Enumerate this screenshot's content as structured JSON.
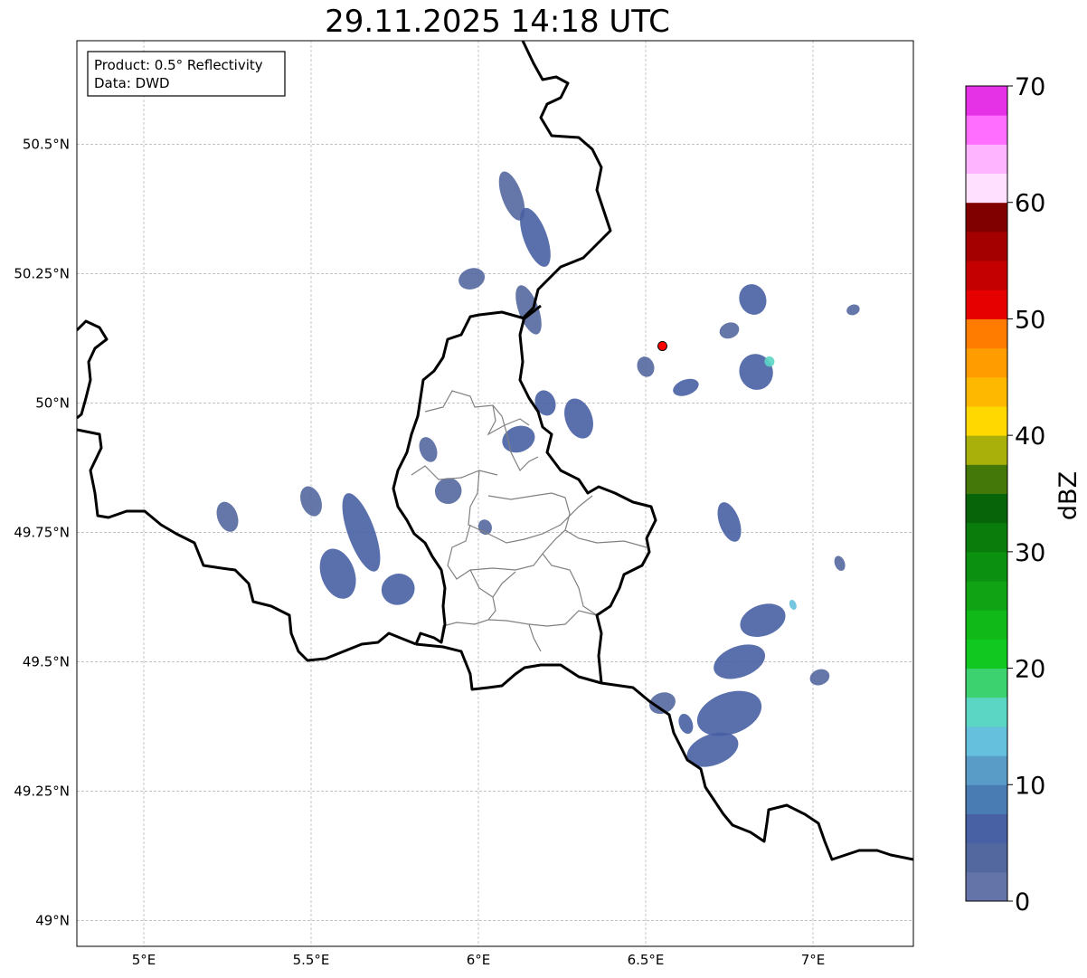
{
  "title": "29.11.2025 14:18 UTC",
  "info": {
    "product": "Product: 0.5° Reflectivity",
    "data": "Data: DWD"
  },
  "map_extent": {
    "lon": [
      4.8,
      7.3
    ],
    "lat": [
      48.95,
      50.7
    ]
  },
  "lon_ticks": [
    {
      "value": 5.0,
      "label": "5°E"
    },
    {
      "value": 5.5,
      "label": "5.5°E"
    },
    {
      "value": 6.0,
      "label": "6°E"
    },
    {
      "value": 6.5,
      "label": "6.5°E"
    },
    {
      "value": 7.0,
      "label": "7°E"
    }
  ],
  "lat_ticks": [
    {
      "value": 49.0,
      "label": "49°N"
    },
    {
      "value": 49.25,
      "label": "49.25°N"
    },
    {
      "value": 49.5,
      "label": "49.5°N"
    },
    {
      "value": 49.75,
      "label": "49.75°N"
    },
    {
      "value": 50.0,
      "label": "50°N"
    },
    {
      "value": 50.25,
      "label": "50.25°N"
    },
    {
      "value": 50.5,
      "label": "50.5°N"
    }
  ],
  "radar_site": {
    "lon": 6.55,
    "lat": 50.11,
    "color": "#ff0000"
  },
  "colorbar": {
    "unit": "dBZ",
    "min": 0,
    "max": 70,
    "ticks": [
      {
        "value": 0,
        "label": "0"
      },
      {
        "value": 10,
        "label": "10"
      },
      {
        "value": 20,
        "label": "20"
      },
      {
        "value": 30,
        "label": "30"
      },
      {
        "value": 40,
        "label": "40"
      },
      {
        "value": 50,
        "label": "50"
      },
      {
        "value": 60,
        "label": "60"
      },
      {
        "value": 70,
        "label": "70"
      }
    ],
    "colors": [
      "#6474a8",
      "#5468a0",
      "#4860a4",
      "#4a7cb4",
      "#5a9cc8",
      "#64c0dc",
      "#5cd6c4",
      "#3cd270",
      "#10c820",
      "#10b818",
      "#10a414",
      "#0c9010",
      "#0a7c0c",
      "#086408",
      "#447808",
      "#aab00a",
      "#ffd800",
      "#ffb800",
      "#ff9c00",
      "#ff7c00",
      "#e60000",
      "#c40000",
      "#a40000",
      "#800000",
      "#ffe0ff",
      "#ffb4ff",
      "#ff6eff",
      "#e632e6"
    ]
  },
  "colors": {
    "country_border": "#000000",
    "admin_border": "#808080",
    "grid": "#b0b0b0",
    "echo_default": "#5068a8"
  },
  "echoes": [
    {
      "lon": 6.1,
      "lat": 50.4,
      "w": 0.06,
      "h": 0.1,
      "value": 4
    },
    {
      "lon": 6.17,
      "lat": 50.32,
      "w": 0.07,
      "h": 0.12,
      "value": 5
    },
    {
      "lon": 6.15,
      "lat": 50.18,
      "w": 0.06,
      "h": 0.1,
      "value": 4
    },
    {
      "lon": 5.98,
      "lat": 50.24,
      "w": 0.08,
      "h": 0.04,
      "value": 3
    },
    {
      "lon": 6.3,
      "lat": 49.97,
      "w": 0.08,
      "h": 0.08,
      "value": 6
    },
    {
      "lon": 6.12,
      "lat": 49.93,
      "w": 0.1,
      "h": 0.05,
      "value": 6
    },
    {
      "lon": 6.2,
      "lat": 50.0,
      "w": 0.06,
      "h": 0.05,
      "value": 5
    },
    {
      "lon": 5.85,
      "lat": 49.91,
      "w": 0.05,
      "h": 0.05,
      "value": 4
    },
    {
      "lon": 5.65,
      "lat": 49.75,
      "w": 0.08,
      "h": 0.16,
      "value": 5
    },
    {
      "lon": 5.58,
      "lat": 49.67,
      "w": 0.1,
      "h": 0.1,
      "value": 6
    },
    {
      "lon": 5.76,
      "lat": 49.64,
      "w": 0.1,
      "h": 0.06,
      "value": 5
    },
    {
      "lon": 5.5,
      "lat": 49.81,
      "w": 0.06,
      "h": 0.06,
      "value": 4
    },
    {
      "lon": 5.91,
      "lat": 49.83,
      "w": 0.08,
      "h": 0.05,
      "value": 4
    },
    {
      "lon": 6.02,
      "lat": 49.76,
      "w": 0.04,
      "h": 0.03,
      "value": 3
    },
    {
      "lon": 5.25,
      "lat": 49.78,
      "w": 0.06,
      "h": 0.06,
      "value": 4
    },
    {
      "lon": 6.75,
      "lat": 49.77,
      "w": 0.06,
      "h": 0.08,
      "value": 5
    },
    {
      "lon": 6.83,
      "lat": 50.06,
      "w": 0.1,
      "h": 0.07,
      "value": 7
    },
    {
      "lon": 6.82,
      "lat": 50.2,
      "w": 0.08,
      "h": 0.06,
      "value": 5
    },
    {
      "lon": 6.75,
      "lat": 50.14,
      "w": 0.06,
      "h": 0.03,
      "value": 4
    },
    {
      "lon": 6.62,
      "lat": 50.03,
      "w": 0.08,
      "h": 0.03,
      "value": 5
    },
    {
      "lon": 6.5,
      "lat": 50.07,
      "w": 0.05,
      "h": 0.04,
      "value": 4
    },
    {
      "lon": 6.85,
      "lat": 49.58,
      "w": 0.14,
      "h": 0.06,
      "value": 5
    },
    {
      "lon": 6.78,
      "lat": 49.5,
      "w": 0.16,
      "h": 0.06,
      "value": 5
    },
    {
      "lon": 6.75,
      "lat": 49.4,
      "w": 0.2,
      "h": 0.08,
      "value": 5
    },
    {
      "lon": 6.7,
      "lat": 49.33,
      "w": 0.16,
      "h": 0.06,
      "value": 6
    },
    {
      "lon": 6.55,
      "lat": 49.42,
      "w": 0.08,
      "h": 0.04,
      "value": 4
    },
    {
      "lon": 6.62,
      "lat": 49.38,
      "w": 0.04,
      "h": 0.04,
      "value": 7
    },
    {
      "lon": 7.02,
      "lat": 49.47,
      "w": 0.06,
      "h": 0.03,
      "value": 4
    },
    {
      "lon": 7.12,
      "lat": 50.18,
      "w": 0.04,
      "h": 0.02,
      "value": 4
    },
    {
      "lon": 7.08,
      "lat": 49.69,
      "w": 0.03,
      "h": 0.03,
      "value": 4
    },
    {
      "lon": 6.94,
      "lat": 49.61,
      "w": 0.02,
      "h": 0.02,
      "value": 14
    },
    {
      "lon": 6.87,
      "lat": 50.08,
      "w": 0.03,
      "h": 0.02,
      "value": 16
    }
  ]
}
